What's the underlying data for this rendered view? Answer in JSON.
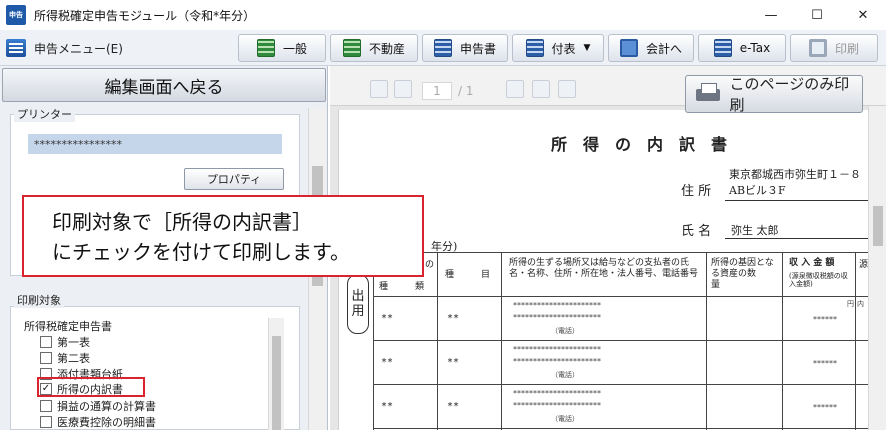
{
  "window": {
    "icon_text": "申告",
    "title": "所得税確定申告モジュール（令和*年分）",
    "minimize": "—",
    "maximize": "☐",
    "close": "✕"
  },
  "toolbar": {
    "menu_label": "申告メニュー(E)",
    "buttons": [
      "一般",
      "不動産",
      "申告書",
      "付表",
      "会計へ",
      "e-Tax",
      "印刷"
    ],
    "dropdown_arrow": "▼"
  },
  "left": {
    "back_button": "編集画面へ戻る",
    "printer_group_title": "プリンター",
    "printer_value": "****************",
    "properties_button": "プロパティ",
    "target_group_title": "印刷対象",
    "category": "所得税確定申告書",
    "items": [
      {
        "label": "第一表",
        "checked": false,
        "mark": ""
      },
      {
        "label": "第二表",
        "checked": false,
        "mark": ""
      },
      {
        "label": "添付書類台紙",
        "checked": false,
        "mark": ""
      },
      {
        "label": "所得の内訳書",
        "checked": true,
        "mark": "✓"
      },
      {
        "label": "損益の通算の計算書",
        "checked": false,
        "mark": ""
      },
      {
        "label": "医療費控除の明細書",
        "checked": false,
        "mark": ""
      }
    ]
  },
  "callout": {
    "line1": "印刷対象で［所得の内訳書］",
    "line2": "にチェックを付けて印刷します。"
  },
  "viewer": {
    "page_current": "1",
    "page_total": "/ 1",
    "print_page_button": "このページのみ印刷"
  },
  "document": {
    "title": "所得の内訳書",
    "address_label": "住 所",
    "address_line1": "東京都城西市弥生町１－８",
    "address_line2": "ABビル３F",
    "name_label": "氏 名",
    "name_value": "弥生 太郎",
    "year_fragment": "年分)",
    "stamp_text": [
      "出",
      "用"
    ],
    "headers": {
      "col_a": "種　　　類",
      "col_a_top": "の",
      "col_b": "種　　　目",
      "col_c": "所得の生ずる場所又は給与などの支払者の氏名・名称、住所・所在地・法人番号、電話番号",
      "col_d": "所得の基因となる資産の数　　　量",
      "col_e": "収 入 金 額",
      "col_e_sub": "(源泉徴収税額の収入金額)",
      "col_f": "源"
    },
    "unit": "円",
    "unit2": "内",
    "rows": [
      {
        "kind": "**",
        "item": "**",
        "payer_line1": "**********************",
        "payer_line2": "**********************",
        "phone": "（電話）",
        "amount": "******"
      },
      {
        "kind": "**",
        "item": "**",
        "payer_line1": "**********************",
        "payer_line2": "**********************",
        "phone": "（電話）",
        "amount": "******"
      },
      {
        "kind": "**",
        "item": "**",
        "payer_line1": "**********************",
        "payer_line2": "**********************",
        "phone": "（電話）",
        "amount": "******"
      }
    ]
  }
}
